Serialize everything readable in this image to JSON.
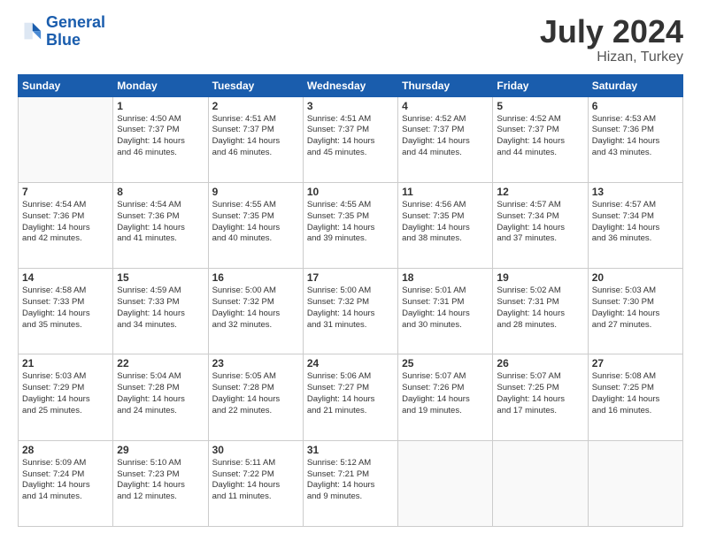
{
  "header": {
    "logo_line1": "General",
    "logo_line2": "Blue",
    "main_title": "July 2024",
    "subtitle": "Hizan, Turkey"
  },
  "days_of_week": [
    "Sunday",
    "Monday",
    "Tuesday",
    "Wednesday",
    "Thursday",
    "Friday",
    "Saturday"
  ],
  "weeks": [
    [
      {
        "day": "",
        "info": ""
      },
      {
        "day": "1",
        "info": "Sunrise: 4:50 AM\nSunset: 7:37 PM\nDaylight: 14 hours\nand 46 minutes."
      },
      {
        "day": "2",
        "info": "Sunrise: 4:51 AM\nSunset: 7:37 PM\nDaylight: 14 hours\nand 46 minutes."
      },
      {
        "day": "3",
        "info": "Sunrise: 4:51 AM\nSunset: 7:37 PM\nDaylight: 14 hours\nand 45 minutes."
      },
      {
        "day": "4",
        "info": "Sunrise: 4:52 AM\nSunset: 7:37 PM\nDaylight: 14 hours\nand 44 minutes."
      },
      {
        "day": "5",
        "info": "Sunrise: 4:52 AM\nSunset: 7:37 PM\nDaylight: 14 hours\nand 44 minutes."
      },
      {
        "day": "6",
        "info": "Sunrise: 4:53 AM\nSunset: 7:36 PM\nDaylight: 14 hours\nand 43 minutes."
      }
    ],
    [
      {
        "day": "7",
        "info": "Sunrise: 4:54 AM\nSunset: 7:36 PM\nDaylight: 14 hours\nand 42 minutes."
      },
      {
        "day": "8",
        "info": "Sunrise: 4:54 AM\nSunset: 7:36 PM\nDaylight: 14 hours\nand 41 minutes."
      },
      {
        "day": "9",
        "info": "Sunrise: 4:55 AM\nSunset: 7:35 PM\nDaylight: 14 hours\nand 40 minutes."
      },
      {
        "day": "10",
        "info": "Sunrise: 4:55 AM\nSunset: 7:35 PM\nDaylight: 14 hours\nand 39 minutes."
      },
      {
        "day": "11",
        "info": "Sunrise: 4:56 AM\nSunset: 7:35 PM\nDaylight: 14 hours\nand 38 minutes."
      },
      {
        "day": "12",
        "info": "Sunrise: 4:57 AM\nSunset: 7:34 PM\nDaylight: 14 hours\nand 37 minutes."
      },
      {
        "day": "13",
        "info": "Sunrise: 4:57 AM\nSunset: 7:34 PM\nDaylight: 14 hours\nand 36 minutes."
      }
    ],
    [
      {
        "day": "14",
        "info": "Sunrise: 4:58 AM\nSunset: 7:33 PM\nDaylight: 14 hours\nand 35 minutes."
      },
      {
        "day": "15",
        "info": "Sunrise: 4:59 AM\nSunset: 7:33 PM\nDaylight: 14 hours\nand 34 minutes."
      },
      {
        "day": "16",
        "info": "Sunrise: 5:00 AM\nSunset: 7:32 PM\nDaylight: 14 hours\nand 32 minutes."
      },
      {
        "day": "17",
        "info": "Sunrise: 5:00 AM\nSunset: 7:32 PM\nDaylight: 14 hours\nand 31 minutes."
      },
      {
        "day": "18",
        "info": "Sunrise: 5:01 AM\nSunset: 7:31 PM\nDaylight: 14 hours\nand 30 minutes."
      },
      {
        "day": "19",
        "info": "Sunrise: 5:02 AM\nSunset: 7:31 PM\nDaylight: 14 hours\nand 28 minutes."
      },
      {
        "day": "20",
        "info": "Sunrise: 5:03 AM\nSunset: 7:30 PM\nDaylight: 14 hours\nand 27 minutes."
      }
    ],
    [
      {
        "day": "21",
        "info": "Sunrise: 5:03 AM\nSunset: 7:29 PM\nDaylight: 14 hours\nand 25 minutes."
      },
      {
        "day": "22",
        "info": "Sunrise: 5:04 AM\nSunset: 7:28 PM\nDaylight: 14 hours\nand 24 minutes."
      },
      {
        "day": "23",
        "info": "Sunrise: 5:05 AM\nSunset: 7:28 PM\nDaylight: 14 hours\nand 22 minutes."
      },
      {
        "day": "24",
        "info": "Sunrise: 5:06 AM\nSunset: 7:27 PM\nDaylight: 14 hours\nand 21 minutes."
      },
      {
        "day": "25",
        "info": "Sunrise: 5:07 AM\nSunset: 7:26 PM\nDaylight: 14 hours\nand 19 minutes."
      },
      {
        "day": "26",
        "info": "Sunrise: 5:07 AM\nSunset: 7:25 PM\nDaylight: 14 hours\nand 17 minutes."
      },
      {
        "day": "27",
        "info": "Sunrise: 5:08 AM\nSunset: 7:25 PM\nDaylight: 14 hours\nand 16 minutes."
      }
    ],
    [
      {
        "day": "28",
        "info": "Sunrise: 5:09 AM\nSunset: 7:24 PM\nDaylight: 14 hours\nand 14 minutes."
      },
      {
        "day": "29",
        "info": "Sunrise: 5:10 AM\nSunset: 7:23 PM\nDaylight: 14 hours\nand 12 minutes."
      },
      {
        "day": "30",
        "info": "Sunrise: 5:11 AM\nSunset: 7:22 PM\nDaylight: 14 hours\nand 11 minutes."
      },
      {
        "day": "31",
        "info": "Sunrise: 5:12 AM\nSunset: 7:21 PM\nDaylight: 14 hours\nand 9 minutes."
      },
      {
        "day": "",
        "info": ""
      },
      {
        "day": "",
        "info": ""
      },
      {
        "day": "",
        "info": ""
      }
    ]
  ]
}
